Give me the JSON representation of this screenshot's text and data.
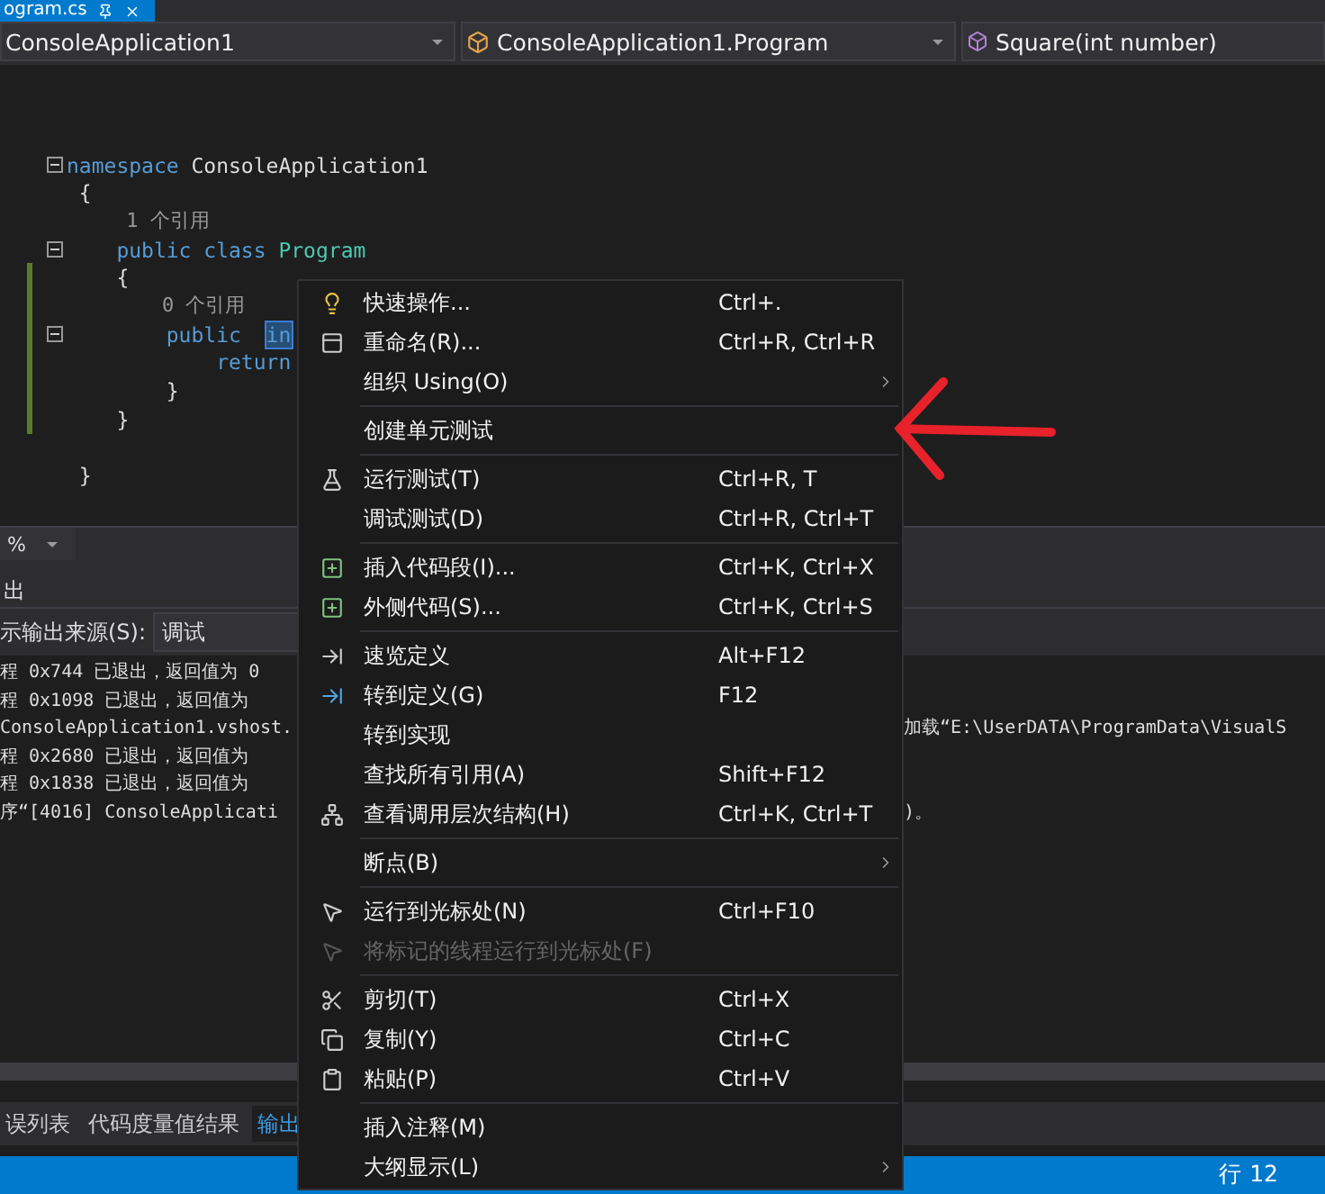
{
  "document_tab": {
    "title": "ogram.cs",
    "selected": true
  },
  "nav_bar": {
    "project": "ConsoleApplication1",
    "class": "ConsoleApplication1.Program",
    "member": "Square(int number)"
  },
  "code_lines": [
    {
      "fold": false,
      "changed": false
    },
    {
      "fold": true,
      "changed": false,
      "tokens": [
        {
          "kind": "keyword",
          "text": "namespace"
        },
        {
          "kind": "plain",
          "text": " ConsoleApplication1"
        }
      ]
    },
    {
      "fold": false,
      "changed": false,
      "tokens": [
        {
          "kind": "plain",
          "text": " {"
        }
      ]
    },
    {
      "fold": false,
      "changed": false,
      "tokens": [
        {
          "kind": "lens",
          "text": "     1 个引用"
        }
      ]
    },
    {
      "fold": true,
      "changed": false,
      "tokens": [
        {
          "kind": "keyword",
          "text": "    public class "
        },
        {
          "kind": "type",
          "text": "Program"
        }
      ]
    },
    {
      "fold": false,
      "changed": true,
      "tokens": [
        {
          "kind": "plain",
          "text": "    {"
        }
      ]
    },
    {
      "fold": false,
      "changed": true,
      "tokens": [
        {
          "kind": "lens",
          "text": "        0 个引用"
        }
      ]
    },
    {
      "fold": true,
      "changed": true,
      "tokens": [
        {
          "kind": "keyword",
          "text": "        public  "
        },
        {
          "kind": "selected",
          "text": "in"
        }
      ]
    },
    {
      "fold": false,
      "changed": true,
      "tokens": [
        {
          "kind": "keyword",
          "text": "            return"
        }
      ]
    },
    {
      "fold": false,
      "changed": true,
      "tokens": [
        {
          "kind": "plain",
          "text": "        }"
        }
      ]
    },
    {
      "fold": false,
      "changed": true,
      "tokens": [
        {
          "kind": "plain",
          "text": "    }"
        }
      ]
    },
    {
      "fold": false,
      "changed": false
    },
    {
      "fold": false,
      "changed": false,
      "tokens": [
        {
          "kind": "plain",
          "text": " }"
        }
      ]
    }
  ],
  "zoom": {
    "value": "%"
  },
  "output_panel": {
    "title": "出",
    "source_label": "示输出来源(S):",
    "source_value": "调试",
    "lines": [
      {
        "left": "程 0x744 已退出，返回值为 0"
      },
      {
        "left": "程 0x1098 已退出，返回值为"
      },
      {
        "left": "ConsoleApplication1.vshost.",
        "right": "加载“E:\\UserDATA\\ProgramData\\VisualS"
      },
      {
        "left": "程 0x2680 已退出，返回值为"
      },
      {
        "left": "程 0x1838 已退出，返回值为"
      },
      {
        "left": "序“[4016] ConsoleApplicati",
        "right": ")。"
      }
    ]
  },
  "bottom_tabs": [
    {
      "label": "误列表",
      "selected": false
    },
    {
      "label": "代码度量值结果",
      "selected": false
    },
    {
      "label": "输出",
      "selected": true
    }
  ],
  "status_bar": {
    "position": "行 12"
  },
  "context_menu": [
    {
      "kind": "item",
      "label": "快速操作...",
      "shortcut": "Ctrl+.",
      "submenu": false,
      "disabled": false
    },
    {
      "kind": "item",
      "label": "重命名(R)...",
      "shortcut": "Ctrl+R, Ctrl+R",
      "submenu": false,
      "disabled": false
    },
    {
      "kind": "item",
      "label": "组织 Using(O)",
      "submenu": true,
      "disabled": false
    },
    {
      "kind": "separator"
    },
    {
      "kind": "item",
      "label": "创建单元测试",
      "submenu": false,
      "disabled": false
    },
    {
      "kind": "separator"
    },
    {
      "kind": "item",
      "label": "运行测试(T)",
      "shortcut": "Ctrl+R, T",
      "submenu": false,
      "disabled": false
    },
    {
      "kind": "item",
      "label": "调试测试(D)",
      "shortcut": "Ctrl+R, Ctrl+T",
      "submenu": false,
      "disabled": false
    },
    {
      "kind": "separator"
    },
    {
      "kind": "item",
      "label": "插入代码段(I)...",
      "shortcut": "Ctrl+K, Ctrl+X",
      "submenu": false,
      "disabled": false
    },
    {
      "kind": "item",
      "label": "外侧代码(S)...",
      "shortcut": "Ctrl+K, Ctrl+S",
      "submenu": false,
      "disabled": false
    },
    {
      "kind": "separator"
    },
    {
      "kind": "item",
      "label": "速览定义",
      "shortcut": "Alt+F12",
      "submenu": false,
      "disabled": false
    },
    {
      "kind": "item",
      "label": "转到定义(G)",
      "shortcut": "F12",
      "submenu": false,
      "disabled": false
    },
    {
      "kind": "item",
      "label": "转到实现",
      "submenu": false,
      "disabled": false
    },
    {
      "kind": "item",
      "label": "查找所有引用(A)",
      "shortcut": "Shift+F12",
      "submenu": false,
      "disabled": false
    },
    {
      "kind": "item",
      "label": "查看调用层次结构(H)",
      "shortcut": "Ctrl+K, Ctrl+T",
      "submenu": false,
      "disabled": false
    },
    {
      "kind": "separator"
    },
    {
      "kind": "item",
      "label": "断点(B)",
      "submenu": true,
      "disabled": false
    },
    {
      "kind": "separator"
    },
    {
      "kind": "item",
      "label": "运行到光标处(N)",
      "shortcut": "Ctrl+F10",
      "submenu": false,
      "disabled": false
    },
    {
      "kind": "item",
      "label": "将标记的线程运行到光标处(F)",
      "submenu": false,
      "disabled": true
    },
    {
      "kind": "separator"
    },
    {
      "kind": "item",
      "label": "剪切(T)",
      "shortcut": "Ctrl+X",
      "submenu": false,
      "disabled": false
    },
    {
      "kind": "item",
      "label": "复制(Y)",
      "shortcut": "Ctrl+C",
      "submenu": false,
      "disabled": false
    },
    {
      "kind": "item",
      "label": "粘贴(P)",
      "shortcut": "Ctrl+V",
      "submenu": false,
      "disabled": false
    },
    {
      "kind": "separator"
    },
    {
      "kind": "item",
      "label": "插入注释(M)",
      "submenu": false,
      "disabled": false
    },
    {
      "kind": "item",
      "label": "大纲显示(L)",
      "submenu": true,
      "disabled": false
    }
  ]
}
